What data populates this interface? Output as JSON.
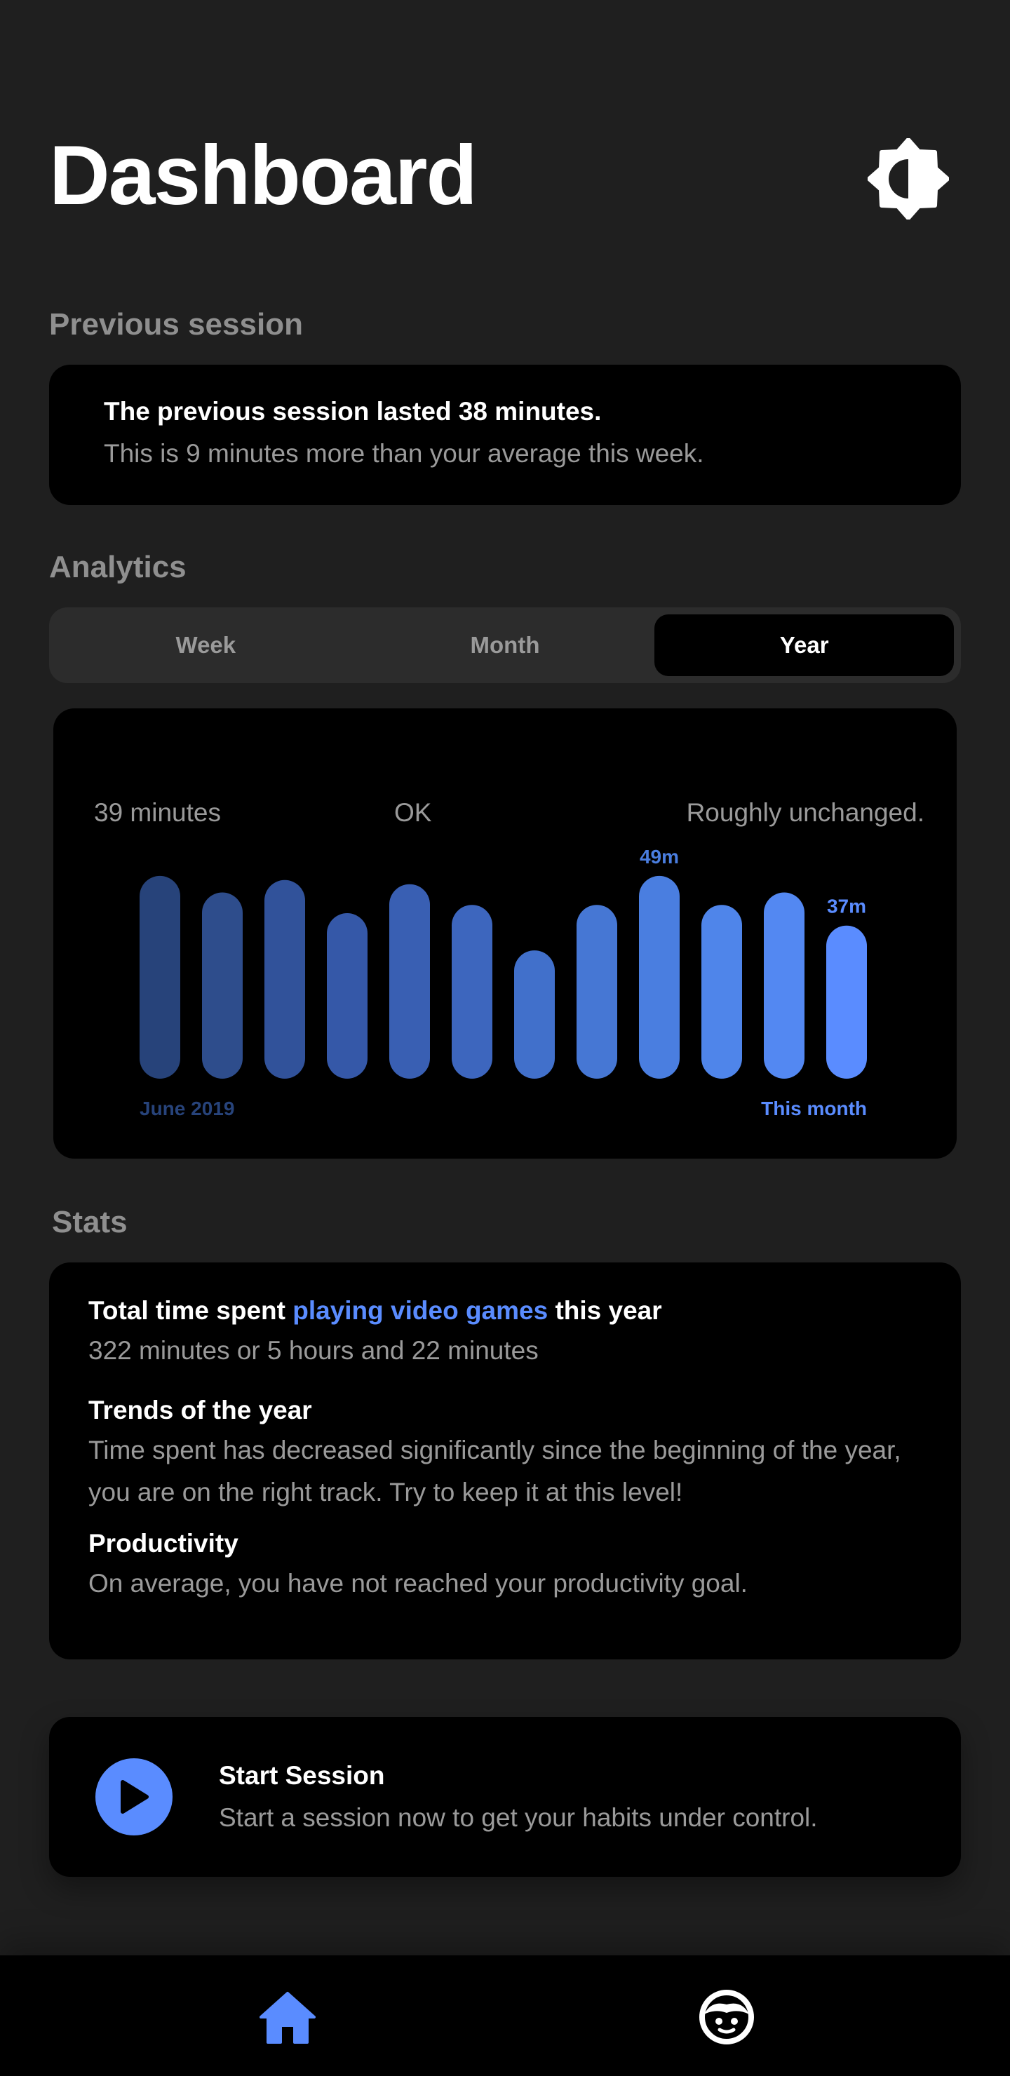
{
  "header": {
    "title": "Dashboard",
    "theme_icon": "brightness-icon"
  },
  "previous_session": {
    "label": "Previous session",
    "title": "The previous session lasted 38 minutes.",
    "subtitle": "This is 9 minutes more than your average this week."
  },
  "analytics": {
    "label": "Analytics",
    "tabs": [
      "Week",
      "Month",
      "Year"
    ],
    "active_tab": "Year",
    "stats": {
      "time": "39 minutes",
      "rating": "OK",
      "trend": "Roughly unchanged."
    }
  },
  "chart_data": {
    "type": "bar",
    "x_start_label": "June 2019",
    "x_end_label": "This month",
    "values": [
      49,
      45,
      48,
      40,
      47,
      42,
      31,
      42,
      49,
      42,
      45,
      37
    ],
    "data_labels": [
      {
        "index": 8,
        "text": "49m"
      },
      {
        "index": 11,
        "text": "37m"
      }
    ],
    "bar_colors": [
      "#27437a",
      "#2e4d8c",
      "#31529a",
      "#3558a8",
      "#395fb3",
      "#3d66be",
      "#4170cb",
      "#4677d4",
      "#4a7ee0",
      "#4f85ea",
      "#5388f2",
      "#5a8cff"
    ]
  },
  "stats": {
    "label": "Stats",
    "total": {
      "title_pre": "Total time spent ",
      "title_highlight": "playing video games",
      "title_post": " this year",
      "text": "322 minutes or 5 hours and 22 minutes"
    },
    "trends": {
      "title": "Trends of the year",
      "text": "Time spent has decreased significantly since the beginning of the year, you are on the right track. Try to keep it at this level!"
    },
    "productivity": {
      "title": "Productivity",
      "text": "On average, you have not reached your productivity goal."
    }
  },
  "session": {
    "title": "Start Session",
    "subtitle": "Start a session now to get your habits under control.",
    "icon": "play-icon"
  },
  "nav": {
    "items": [
      {
        "icon": "home-icon",
        "active": true
      },
      {
        "icon": "profile-face-icon",
        "active": false
      }
    ]
  },
  "colors": {
    "accent": "#5a8cff",
    "background": "#1f1f1f",
    "card": "#000000",
    "muted": "#9a9a9a"
  }
}
